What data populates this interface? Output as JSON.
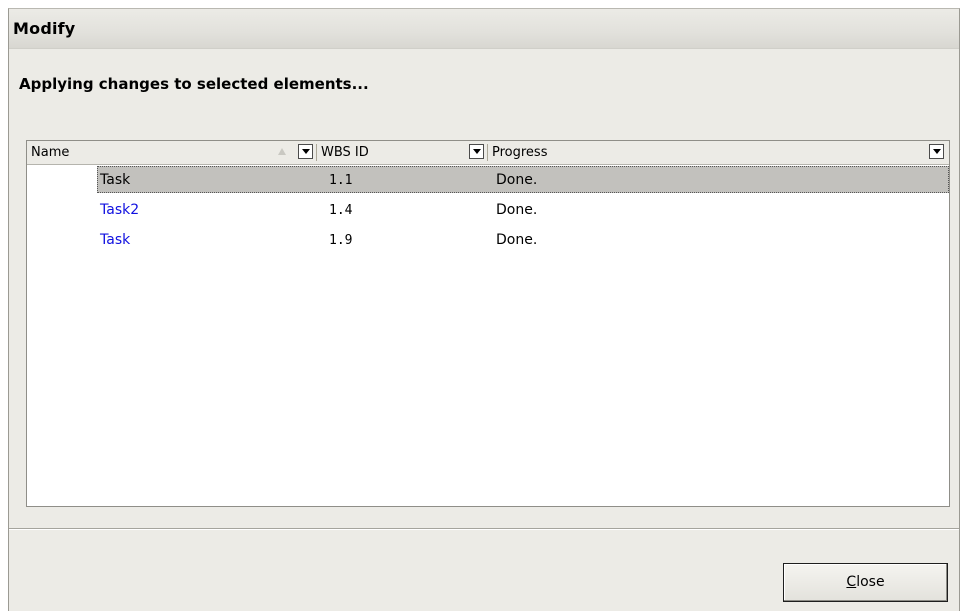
{
  "window": {
    "title": "Modify"
  },
  "status_text": "Applying changes to selected elements...",
  "grid": {
    "columns": [
      {
        "label": "Name",
        "sorted": "ascending",
        "has_dropdown": true
      },
      {
        "label": "WBS ID",
        "has_dropdown": true
      },
      {
        "label": "Progress",
        "has_dropdown": true
      }
    ],
    "rows": [
      {
        "name": "Task",
        "wbs_id": "1.1",
        "progress": "Done.",
        "selected": true
      },
      {
        "name": "Task2",
        "wbs_id": "1.4",
        "progress": "Done.",
        "selected": false
      },
      {
        "name": "Task",
        "wbs_id": "1.9",
        "progress": "Done.",
        "selected": false
      }
    ]
  },
  "buttons": {
    "close_label_mnemonic": "C",
    "close_label_rest": "lose"
  },
  "colors": {
    "link_text": "#1010e0",
    "selection": "#c2c1bd",
    "dialog_background": "#ecebe6"
  },
  "icons": {
    "sort": "sort-ascending-icon",
    "dropdown": "chevron-down-icon"
  }
}
